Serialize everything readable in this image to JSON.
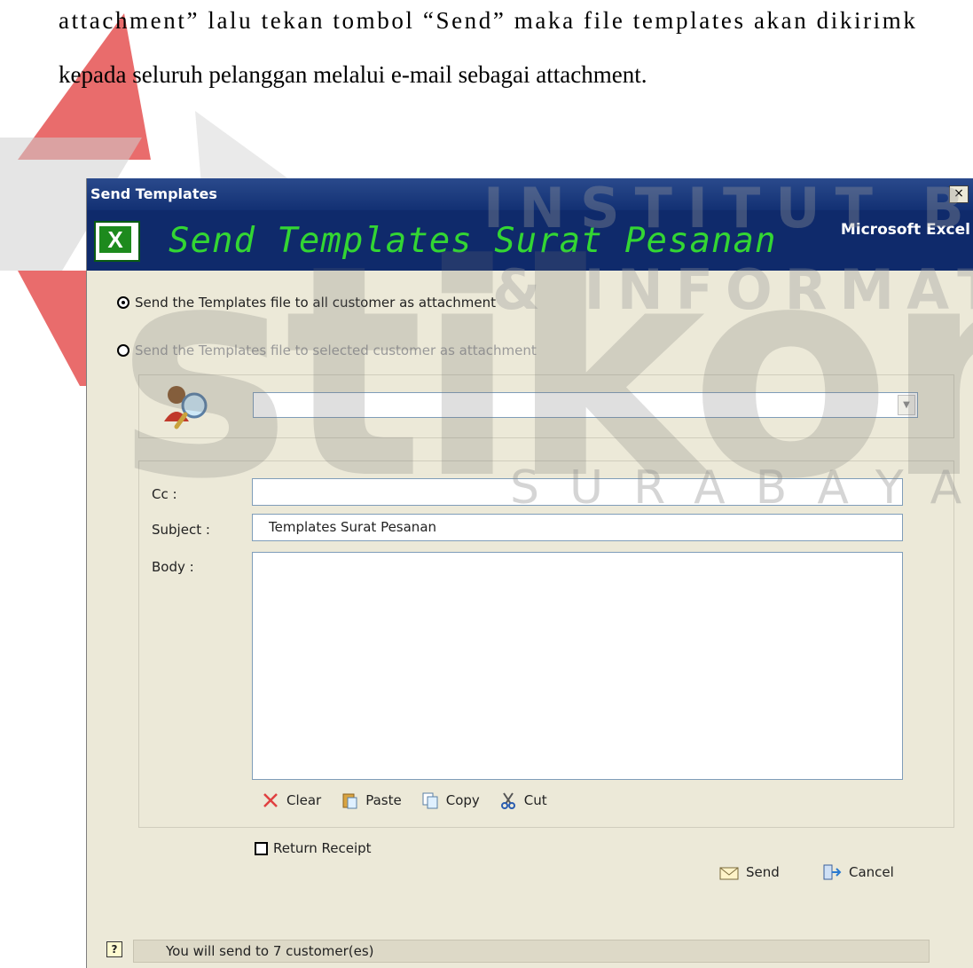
{
  "document": {
    "line1": "attachment” lalu tekan tombol “Send” maka file templates akan dikirimk",
    "line2": "kepada seluruh pelanggan melalui e-mail sebagai attachment."
  },
  "watermark": {
    "institut": "INSTITUT BISNIS",
    "informatika": "& INFORMATIKA",
    "stikom": "stikom",
    "surabaya": "SURABAYA"
  },
  "dialog": {
    "title": "Send Templates",
    "close_label": "×",
    "banner_title": "Send Templates Surat Pesanan",
    "banner_app": "Microsoft Excel",
    "radio_all": "Send the Templates file to all customer as attachment",
    "radio_selected": "Send the Templates file to selected customer as attachment",
    "customer_select_value": "",
    "cc_label": "Cc :",
    "cc_value": "",
    "subject_label": "Subject :",
    "subject_value": "Templates Surat Pesanan",
    "body_label": "Body :",
    "body_value": "",
    "toolbar": {
      "clear": "Clear",
      "paste": "Paste",
      "copy": "Copy",
      "cut": "Cut"
    },
    "return_receipt": "Return Receipt",
    "send": "Send",
    "cancel": "Cancel",
    "help_icon": "?",
    "status_text": "You will send to 7 customer(es)"
  },
  "icons": {
    "excel": "excel-icon",
    "search_user": "search-user-icon",
    "clear": "x-icon",
    "paste": "clipboard-icon",
    "copy": "copy-icon",
    "cut": "scissors-icon",
    "send": "envelope-icon",
    "cancel": "exit-door-icon"
  },
  "colors": {
    "titlebar": "#123073",
    "banner": "#0f2a6b",
    "banner_text": "#33d633",
    "dialog_bg": "#ece9d8"
  }
}
